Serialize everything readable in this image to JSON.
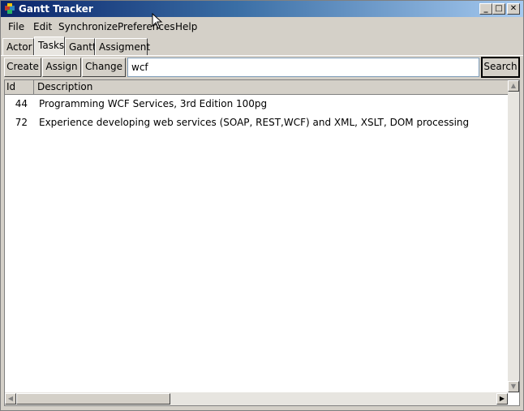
{
  "window": {
    "title": "Gantt Tracker",
    "minimize": "_",
    "maximize": "□",
    "close": "✕"
  },
  "menu": [
    "File",
    "Edit",
    "Synchronize",
    "Preferences",
    "Help"
  ],
  "tabs": [
    "Actor",
    "Tasks",
    "Gantt",
    "Assigment"
  ],
  "active_tab": "Tasks",
  "toolbar": {
    "create_label": "Create",
    "assign_label": "Assign",
    "change_label": "Change",
    "search_value": "wcf",
    "search_label": "Search"
  },
  "table": {
    "columns": [
      "Id",
      "Description"
    ],
    "rows": [
      {
        "id": "44",
        "description": "Programming WCF Services, 3rd Edition 100pg"
      },
      {
        "id": "72",
        "description": "Experience developing web services (SOAP, REST,WCF) and XML, XSLT, DOM processing"
      }
    ]
  },
  "icons": {
    "app": "app-cube-icon",
    "scroll_up": "arrow-up-icon",
    "scroll_down": "arrow-down-icon",
    "scroll_left": "arrow-left-icon",
    "scroll_right": "arrow-right-icon",
    "cursor": "mouse-pointer-icon"
  },
  "colors": {
    "title_bar_start": "#0a246a",
    "title_bar_end": "#a6caf0",
    "window_bg": "#d4d0c8"
  }
}
